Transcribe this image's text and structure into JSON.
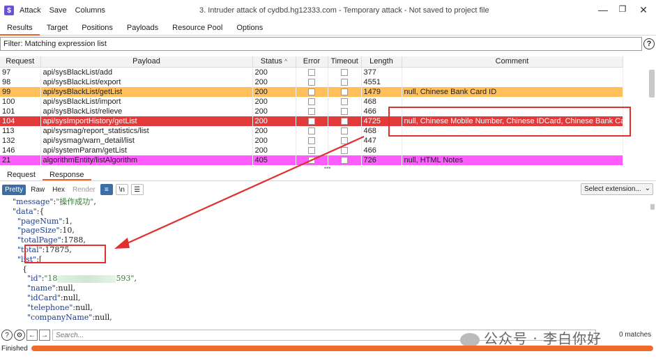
{
  "app": {
    "logo_glyph": "$",
    "menu": [
      "Attack",
      "Save",
      "Columns"
    ],
    "window_title": "3. Intruder attack of cydbd.hg12333.com - Temporary attack - Not saved to project file"
  },
  "tabs": [
    "Results",
    "Target",
    "Positions",
    "Payloads",
    "Resource Pool",
    "Options"
  ],
  "filter": {
    "text": "Filter: Matching expression list"
  },
  "table": {
    "headers": [
      "Request",
      "Payload",
      "Status",
      "Error",
      "Timeout",
      "Length",
      "Comment"
    ],
    "sort_arrow": "^",
    "rows": [
      {
        "request": "97",
        "payload": "api/sysBlackList/add",
        "status": "200",
        "length": "377",
        "comment": "",
        "highlight": "none"
      },
      {
        "request": "98",
        "payload": "api/sysBlackList/export",
        "status": "200",
        "length": "4551",
        "comment": "",
        "highlight": "none"
      },
      {
        "request": "99",
        "payload": "api/sysBlackList/getList",
        "status": "200",
        "length": "1479",
        "comment": "null, Chinese Bank Card ID",
        "highlight": "orange"
      },
      {
        "request": "100",
        "payload": "api/sysBlackList/import",
        "status": "200",
        "length": "468",
        "comment": "",
        "highlight": "none"
      },
      {
        "request": "101",
        "payload": "api/sysBlackList/relieve",
        "status": "200",
        "length": "466",
        "comment": "",
        "highlight": "none"
      },
      {
        "request": "104",
        "payload": "api/sysImportHistory/getList",
        "status": "200",
        "length": "4725",
        "comment": "null, Chinese Mobile Number, Chinese IDCard, Chinese Bank Card ID",
        "highlight": "red"
      },
      {
        "request": "113",
        "payload": "api/sysmag/report_statistics/list",
        "status": "200",
        "length": "468",
        "comment": "",
        "highlight": "none"
      },
      {
        "request": "132",
        "payload": "api/sysmag/warn_detail/list",
        "status": "200",
        "length": "447",
        "comment": "",
        "highlight": "none"
      },
      {
        "request": "146",
        "payload": "api/systemParam/getList",
        "status": "200",
        "length": "466",
        "comment": "",
        "highlight": "none"
      },
      {
        "request": "21",
        "payload": "algorithmEntity/listAlgorithm",
        "status": "405",
        "length": "726",
        "comment": "null, HTML Notes",
        "highlight": "magenta"
      }
    ]
  },
  "subtabs": [
    "Request",
    "Response"
  ],
  "toolbar": {
    "buttons": [
      "Pretty",
      "Raw",
      "Hex",
      "Render"
    ],
    "select_extension": "Select extension...",
    "icon_wrap": "≡",
    "icon_newline": "\\n",
    "icon_menu": "☰"
  },
  "code": {
    "l1_key": "\"message\"",
    "l1_val": "\"操作成功\"",
    "l2_key": "\"data\"",
    "l3_key": "\"pageNum\"",
    "l3_val": "1",
    "l4_key": "\"pageSize\"",
    "l4_val": "10",
    "l5_key": "\"totalPage\"",
    "l5_val": "1788",
    "l6_key": "\"total\"",
    "l6_val": "17875",
    "l7_key": "\"list\"",
    "l9_key": "\"id\"",
    "l9_val_a": "\"18",
    "l9_val_b": "593\"",
    "l10_key": "\"name\"",
    "l10_val": "null",
    "l11_key": "\"idCard\"",
    "l11_val": "null",
    "l12_key": "\"telephone\"",
    "l12_val": "null",
    "l13_key": "\"companyName\"",
    "l13_val": "null"
  },
  "search": {
    "placeholder": "Search...",
    "matches": "0 matches"
  },
  "status": {
    "text": "Finished",
    "progress": 1.0
  },
  "watermark": {
    "text": "公众号 · 李白你好"
  },
  "colors": {
    "accent": "#e8622c",
    "red_row": "#e23a3a",
    "orange_row": "#ffc05c",
    "magenta_row": "#ff5cff",
    "annotation": "#e03030"
  }
}
